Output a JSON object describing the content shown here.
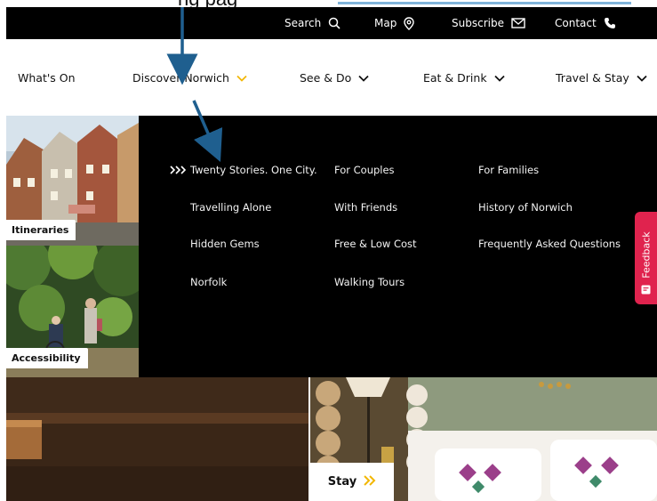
{
  "caption": {
    "fragment": "ng pag"
  },
  "utility_nav": {
    "search_label": "Search",
    "map_label": "Map",
    "subscribe_label": "Subscribe",
    "contact_label": "Contact"
  },
  "main_nav": {
    "items": [
      {
        "label": "What's On"
      },
      {
        "label": "Discover Norwich"
      },
      {
        "label": "See & Do"
      },
      {
        "label": "Eat & Drink"
      },
      {
        "label": "Travel & Stay"
      }
    ],
    "active_chevron_color": "#f2b705"
  },
  "mega_menu": {
    "cards": [
      {
        "label": "Itineraries"
      },
      {
        "label": "Accessibility"
      }
    ],
    "links": [
      {
        "label": "Twenty Stories. One City."
      },
      {
        "label": "Travelling Alone"
      },
      {
        "label": "Hidden Gems"
      },
      {
        "label": "Norfolk"
      },
      {
        "label": "For Couples"
      },
      {
        "label": "With Friends"
      },
      {
        "label": "Free & Low Cost"
      },
      {
        "label": "Walking Tours"
      },
      {
        "label": "For Families"
      },
      {
        "label": "History of Norwich"
      },
      {
        "label": "Frequently Asked Questions"
      }
    ]
  },
  "feedback": {
    "label": "Feedback",
    "color": "#e0234e"
  },
  "promo": {
    "stay_label": "Stay"
  },
  "colors": {
    "accent": "#f2b705",
    "arrow": "#1f5f8f"
  }
}
